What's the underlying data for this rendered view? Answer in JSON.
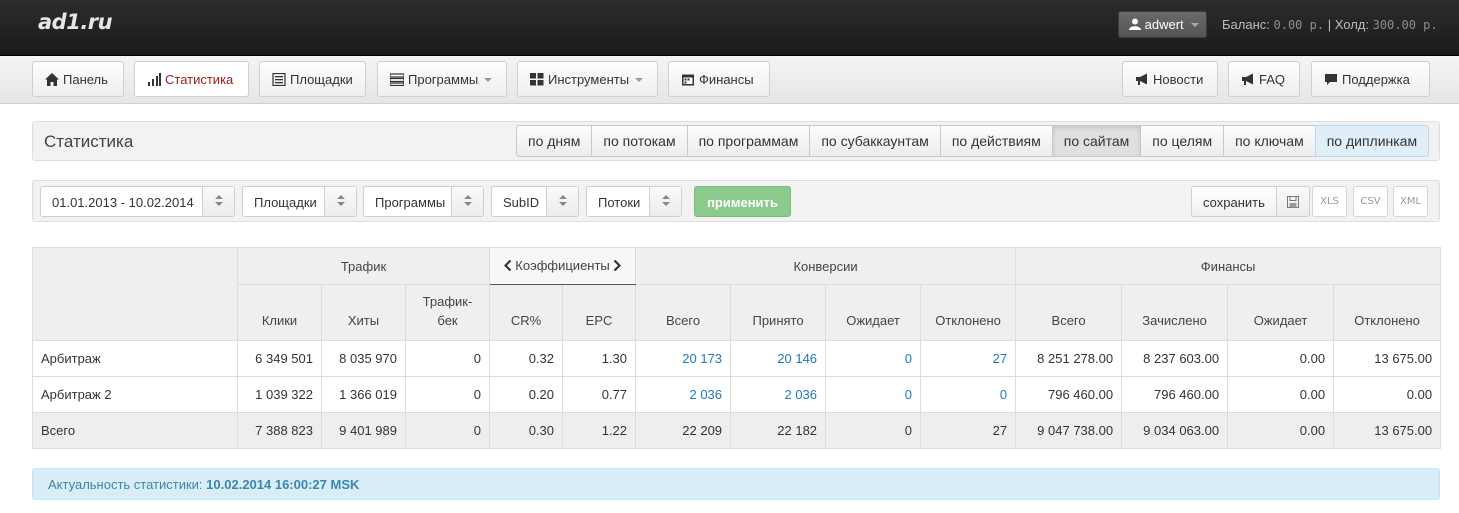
{
  "app": {
    "logo": "ad1.ru",
    "user": "adwert",
    "balance_label": "Баланс:",
    "balance_value": "0.00 р.",
    "separator": "|",
    "hold_label": "Холд:",
    "hold_value": "300.00 р."
  },
  "nav": {
    "left": [
      {
        "label": "Панель",
        "icon": "home-icon"
      },
      {
        "label": "Статистика",
        "icon": "signal-icon",
        "active": true
      },
      {
        "label": "Площадки",
        "icon": "list-icon"
      },
      {
        "label": "Программы",
        "icon": "tasks-icon",
        "dropdown": true
      },
      {
        "label": "Инструменты",
        "icon": "grid-icon",
        "dropdown": true
      },
      {
        "label": "Финансы",
        "icon": "calendar-icon"
      }
    ],
    "right": [
      {
        "label": "Новости",
        "icon": "bullhorn-icon"
      },
      {
        "label": "FAQ",
        "icon": "bullhorn-icon"
      },
      {
        "label": "Поддержка",
        "icon": "comment-icon"
      }
    ]
  },
  "section": {
    "title": "Статистика",
    "views": [
      "по дням",
      "по потокам",
      "по программам",
      "по субаккаунтам",
      "по действиям",
      "по сайтам",
      "по целям",
      "по ключам",
      "по диплинкам"
    ],
    "active_view": "по сайтам"
  },
  "filters": {
    "date_range": "01.01.2013 - 10.02.2014",
    "sites": "Площадки",
    "programs": "Программы",
    "subid": "SubID",
    "streams": "Потоки",
    "apply": "применить",
    "save": "сохранить",
    "exports": [
      "XLS",
      "CSV",
      "XML"
    ]
  },
  "table": {
    "groups": {
      "traffic": "Трафик",
      "coefficients": "Коэффициенты",
      "conversions": "Конверсии",
      "finance": "Финансы"
    },
    "columns": [
      "Клики",
      "Хиты",
      "Трафик-бек",
      "CR%",
      "EPC",
      "Всего",
      "Принято",
      "Ожидает",
      "Отклонено",
      "Всего",
      "Зачислено",
      "Ожидает",
      "Отклонено"
    ],
    "rows": [
      {
        "name": "Арбитраж",
        "cells": [
          "6 349 501",
          "8 035 970",
          "0",
          "0.32",
          "1.30",
          "20 173",
          "20 146",
          "0",
          "27",
          "8 251 278.00",
          "8 237 603.00",
          "0.00",
          "13 675.00"
        ]
      },
      {
        "name": "Арбитраж 2",
        "cells": [
          "1 039 322",
          "1 366 019",
          "0",
          "0.20",
          "0.77",
          "2 036",
          "2 036",
          "0",
          "0",
          "796 460.00",
          "796 460.00",
          "0.00",
          "0.00"
        ]
      }
    ],
    "total": {
      "name": "Всего",
      "cells": [
        "7 388 823",
        "9 401 989",
        "0",
        "0.30",
        "1.22",
        "22 209",
        "22 182",
        "0",
        "27",
        "9 047 738.00",
        "9 034 063.00",
        "0.00",
        "13 675.00"
      ]
    }
  },
  "alert": {
    "label": "Актуальность статистики:",
    "value": "10.02.2014 16:00:27 MSK"
  },
  "colors": {
    "active_nav": "#9b1d1d",
    "link": "#2479b5",
    "apply": "#8cc98c",
    "alert_bg": "#d9edf7",
    "alert_text": "#3a87ad"
  }
}
